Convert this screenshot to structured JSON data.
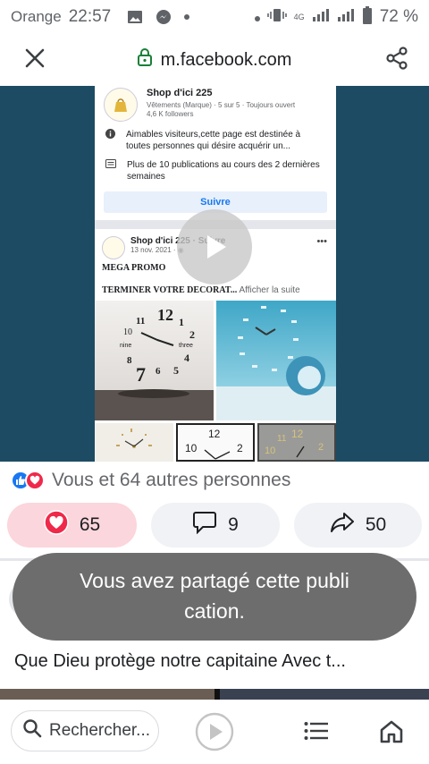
{
  "status_bar": {
    "carrier": "Orange",
    "time": "22:57",
    "network": "4G",
    "battery": "72 %"
  },
  "browser": {
    "url": "m.facebook.com",
    "close_icon": "close-icon",
    "lock_icon": "lock-icon",
    "share_icon": "share-icon"
  },
  "media": {
    "page_name": "Shop d'ici 225",
    "page_meta": "Vêtements (Marque) · 5 sur 5 · Toujours ouvert",
    "page_followers": "4,6 K followers",
    "page_info_1": "Aimables visiteurs,cette page est destinée à toutes personnes qui désire acquérir un...",
    "page_info_2": "Plus de 10 publications au cours des 2 dernières semaines",
    "follow_label": "Suivre",
    "post_name": "Shop d'ici 225 · Suivre",
    "post_date": "13 nov. 2021 · ",
    "post_title": "MEGA PROMO",
    "post_text": "TERMINER VOTRE DECORAT...",
    "post_more": " Afficher la suite",
    "play_icon": "play-icon"
  },
  "reactions": {
    "text": "Vous et 64 autres personnes",
    "colors": {
      "like": "#1877f2",
      "love": "#f02849"
    }
  },
  "actions": {
    "reactions_count": "65",
    "comments_count": "9",
    "shares_count": "50"
  },
  "toast": {
    "message": "Vous avez partagé cette publi cation."
  },
  "caption": {
    "text": "Que Dieu protège notre capitaine Avec t..."
  },
  "bottom_bar": {
    "search_label": "Rechercher..."
  }
}
